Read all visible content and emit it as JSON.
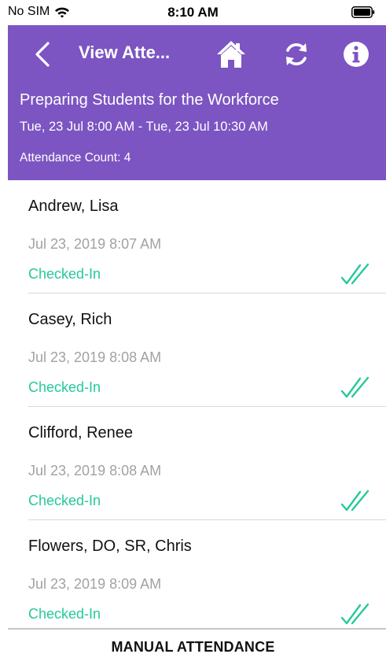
{
  "status_bar": {
    "carrier": "No SIM",
    "time": "8:10 AM",
    "wifi_icon": "wifi-icon",
    "battery_icon": "battery-icon"
  },
  "nav": {
    "title": "View Atte...",
    "back_icon": "chevron-left-icon",
    "home_icon": "home-icon",
    "refresh_icon": "refresh-icon",
    "info_icon": "info-icon"
  },
  "event": {
    "title": "Preparing Students for the Workforce",
    "time_range": "Tue, 23 Jul 8:00 AM - Tue, 23 Jul 10:30 AM",
    "attendance_count": "Attendance Count: 4"
  },
  "attendees": [
    {
      "name": "Andrew, Lisa",
      "timestamp": "Jul 23, 2019 8:07 AM",
      "status": "Checked-In",
      "status_icon": "double-check-icon"
    },
    {
      "name": "Casey, Rich",
      "timestamp": "Jul 23, 2019 8:08 AM",
      "status": "Checked-In",
      "status_icon": "double-check-icon"
    },
    {
      "name": "Clifford, Renee",
      "timestamp": "Jul 23, 2019 8:08 AM",
      "status": "Checked-In",
      "status_icon": "double-check-icon"
    },
    {
      "name": "Flowers, DO, SR, Chris",
      "timestamp": "Jul 23, 2019 8:09 AM",
      "status": "Checked-In",
      "status_icon": "double-check-icon"
    }
  ],
  "footer": {
    "button_label": "MANUAL ATTENDANCE"
  },
  "colors": {
    "header_purple": "#7c55c2",
    "status_green": "#25c99a",
    "timestamp_gray": "#a2a2a2",
    "divider_gray": "#d9d9d9"
  }
}
